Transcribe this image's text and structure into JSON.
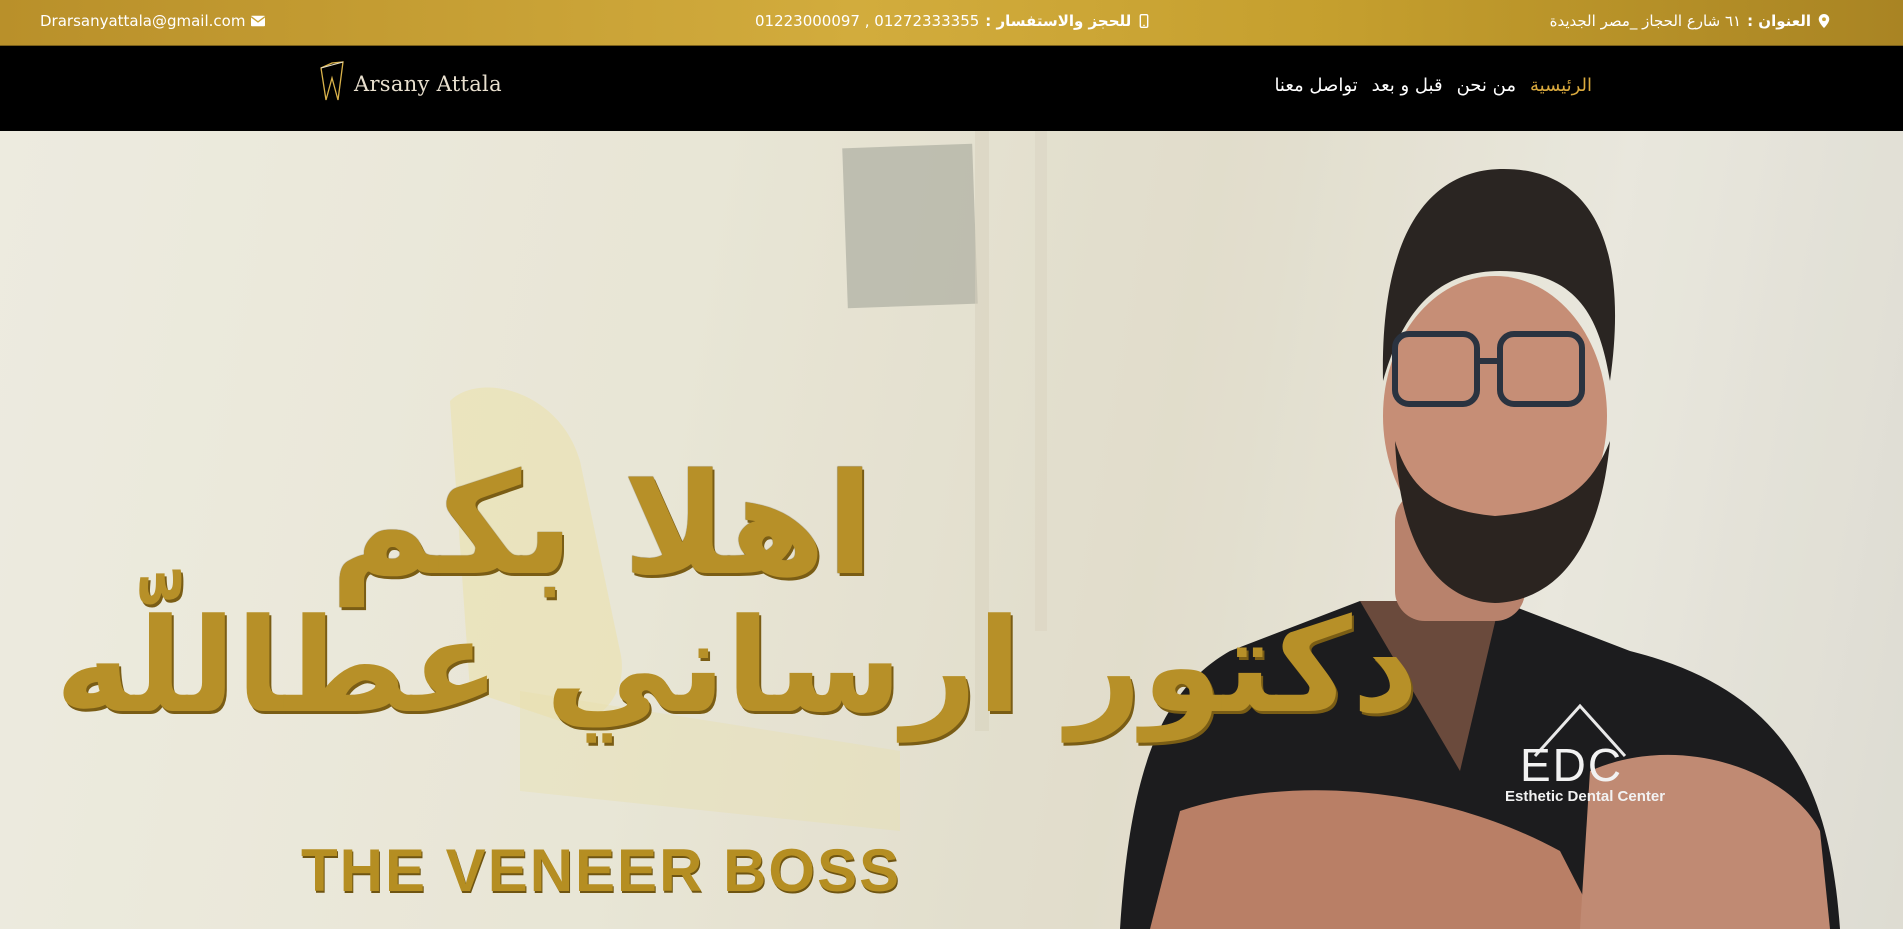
{
  "topbar": {
    "email": "Drarsanyattala@gmail.com",
    "phone_label": "للحجز والاستفسار :",
    "phone_numbers": "01272333355 , 01223000097",
    "address_label": "العنوان :",
    "address_value": "٦١ شارع الحجاز _مصر الجديدة"
  },
  "navbar": {
    "logo_text": "Arsany Attala",
    "items": [
      {
        "label": "الرئيسية",
        "active": true
      },
      {
        "label": "من نحن"
      },
      {
        "label": "قبل و بعد"
      },
      {
        "label": "تواصل معنا"
      }
    ]
  },
  "hero": {
    "welcome": "اهلا بكم",
    "doctor_name": "دكتور ارساني عطاللّه",
    "tagline": "THE VENEER BOSS",
    "scrubs_brand": "EDC",
    "scrubs_subtitle": "Esthetic Dental Center"
  },
  "colors": {
    "gold": "#d9a93e",
    "topbar_gold": "#c9a233",
    "navbar_bg": "#000000"
  },
  "icons": [
    "envelope-icon",
    "mobile-phone-icon",
    "map-marker-icon"
  ]
}
